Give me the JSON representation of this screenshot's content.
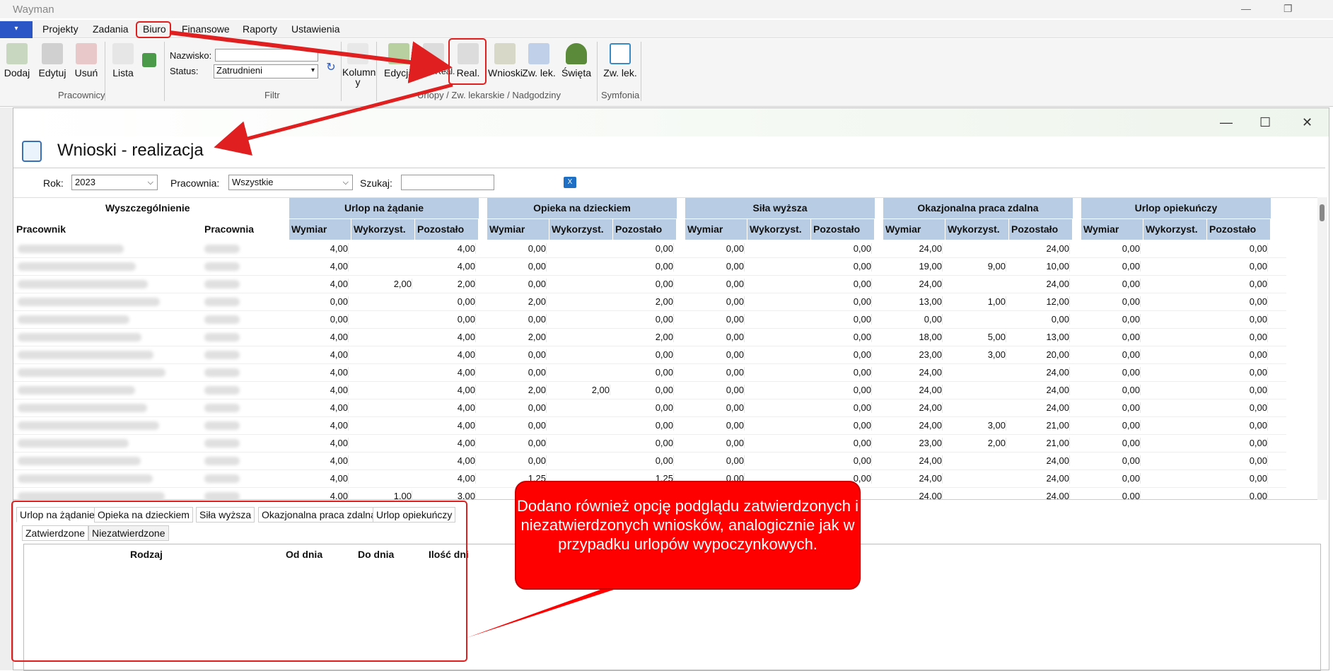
{
  "app": {
    "title": "Wayman",
    "home_label": "▾"
  },
  "menu": [
    "Projekty",
    "Zadania",
    "Biuro",
    "Finansowe",
    "Raporty",
    "Ustawienia"
  ],
  "ribbon": {
    "pracownicy": {
      "buttons": [
        "Dodaj",
        "Edytuj",
        "Usuń",
        "Lista"
      ],
      "group": "Pracownicy"
    },
    "filtr": {
      "nazwisko_label": "Nazwisko:",
      "nazwisko_value": "",
      "status_label": "Status:",
      "status_value": "Zatrudnieni",
      "kolumny": "Kolumn y",
      "group": "Filtr"
    },
    "urlopy": {
      "buttons": [
        "Edycja",
        "Plan/Real.",
        "Real.",
        "Wnioski",
        "Zw. lek.",
        "Święta"
      ],
      "group": "Urlopy / Zw. lekarskie / Nadgodziny"
    },
    "symfonia": {
      "buttons": [
        "Zw. lek."
      ],
      "group": "Symfonia"
    }
  },
  "window": {
    "title": "Wnioski - realizacja",
    "controls": [
      "—",
      "☐",
      "✕"
    ]
  },
  "filters": {
    "rok_label": "Rok:",
    "rok_value": "2023",
    "pracownia_label": "Pracownia:",
    "pracownia_value": "Wszystkie",
    "szukaj_label": "Szukaj:",
    "szukaj_value": ""
  },
  "grid": {
    "head_left": "Wyszczególnienie",
    "col_pracownik": "Pracownik",
    "col_pracownia": "Pracownia",
    "bands": [
      "Urlop na żądanie",
      "Opieka na dzieckiem",
      "Siła wyższa",
      "Okazjonalna praca zdalna",
      "Urlop opiekuńczy"
    ],
    "sub": [
      "Wymiar",
      "Wykorzyst.",
      "Pozostało"
    ],
    "rows": [
      [
        "4,00",
        "",
        "4,00",
        "0,00",
        "",
        "0,00",
        "0,00",
        "",
        "0,00",
        "24,00",
        "",
        "24,00",
        "0,00",
        "",
        "0,00"
      ],
      [
        "4,00",
        "",
        "4,00",
        "0,00",
        "",
        "0,00",
        "0,00",
        "",
        "0,00",
        "19,00",
        "9,00",
        "10,00",
        "0,00",
        "",
        "0,00"
      ],
      [
        "4,00",
        "2,00",
        "2,00",
        "0,00",
        "",
        "0,00",
        "0,00",
        "",
        "0,00",
        "24,00",
        "",
        "24,00",
        "0,00",
        "",
        "0,00"
      ],
      [
        "0,00",
        "",
        "0,00",
        "2,00",
        "",
        "2,00",
        "0,00",
        "",
        "0,00",
        "13,00",
        "1,00",
        "12,00",
        "0,00",
        "",
        "0,00"
      ],
      [
        "0,00",
        "",
        "0,00",
        "0,00",
        "",
        "0,00",
        "0,00",
        "",
        "0,00",
        "0,00",
        "",
        "0,00",
        "0,00",
        "",
        "0,00"
      ],
      [
        "4,00",
        "",
        "4,00",
        "2,00",
        "",
        "2,00",
        "0,00",
        "",
        "0,00",
        "18,00",
        "5,00",
        "13,00",
        "0,00",
        "",
        "0,00"
      ],
      [
        "4,00",
        "",
        "4,00",
        "0,00",
        "",
        "0,00",
        "0,00",
        "",
        "0,00",
        "23,00",
        "3,00",
        "20,00",
        "0,00",
        "",
        "0,00"
      ],
      [
        "4,00",
        "",
        "4,00",
        "0,00",
        "",
        "0,00",
        "0,00",
        "",
        "0,00",
        "24,00",
        "",
        "24,00",
        "0,00",
        "",
        "0,00"
      ],
      [
        "4,00",
        "",
        "4,00",
        "2,00",
        "2,00",
        "0,00",
        "0,00",
        "",
        "0,00",
        "24,00",
        "",
        "24,00",
        "0,00",
        "",
        "0,00"
      ],
      [
        "4,00",
        "",
        "4,00",
        "0,00",
        "",
        "0,00",
        "0,00",
        "",
        "0,00",
        "24,00",
        "",
        "24,00",
        "0,00",
        "",
        "0,00"
      ],
      [
        "4,00",
        "",
        "4,00",
        "0,00",
        "",
        "0,00",
        "0,00",
        "",
        "0,00",
        "24,00",
        "3,00",
        "21,00",
        "0,00",
        "",
        "0,00"
      ],
      [
        "4,00",
        "",
        "4,00",
        "0,00",
        "",
        "0,00",
        "0,00",
        "",
        "0,00",
        "23,00",
        "2,00",
        "21,00",
        "0,00",
        "",
        "0,00"
      ],
      [
        "4,00",
        "",
        "4,00",
        "0,00",
        "",
        "0,00",
        "0,00",
        "",
        "0,00",
        "24,00",
        "",
        "24,00",
        "0,00",
        "",
        "0,00"
      ],
      [
        "4,00",
        "",
        "4,00",
        "1,25",
        "",
        "1,25",
        "0,00",
        "",
        "0,00",
        "24,00",
        "",
        "24,00",
        "0,00",
        "",
        "0,00"
      ],
      [
        "4,00",
        "1,00",
        "3,00",
        "",
        "",
        "",
        "",
        "",
        "",
        "24,00",
        "",
        "24,00",
        "0,00",
        "",
        "0,00"
      ]
    ]
  },
  "tabs": [
    "Urlop na żądanie",
    "Opieka na dzieckiem",
    "Siła wyższa",
    "Okazjonalna praca zdalna",
    "Urlop opiekuńczy"
  ],
  "subtabs": [
    "Zatwierdzone",
    "Niezatwierdzone"
  ],
  "detail_cols": [
    "Rodzaj",
    "Od dnia",
    "Do dnia",
    "Ilość dni"
  ],
  "callout": "Dodano również opcję podglądu zatwierdzonych i niezatwierdzonych wniosków, analogicznie jak w przypadku urlopów wypoczynkowych.",
  "colors": {
    "accent": "#2b57c6",
    "header_band": "#b8cce4",
    "highlight": "#e02020",
    "callout": "#ff0000"
  }
}
